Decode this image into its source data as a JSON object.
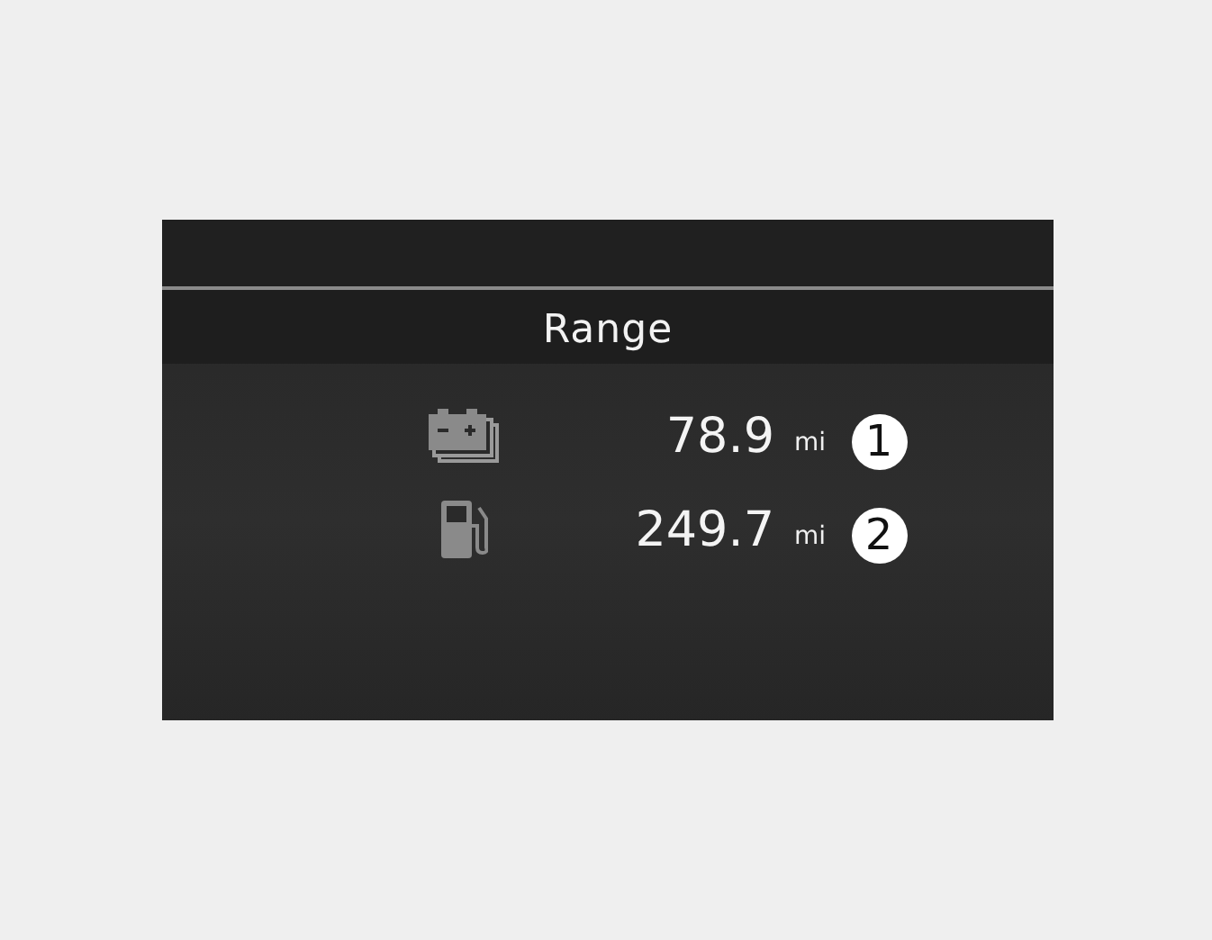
{
  "display": {
    "title": "Range",
    "rows": [
      {
        "kind": "battery",
        "value": "78.9",
        "unit": "mi",
        "callout": "1"
      },
      {
        "kind": "fuel",
        "value": "249.7",
        "unit": "mi",
        "callout": "2"
      }
    ]
  }
}
